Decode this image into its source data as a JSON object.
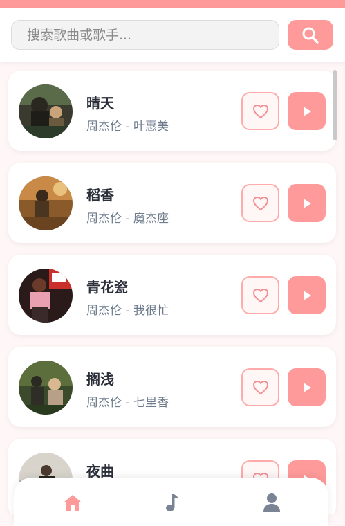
{
  "search": {
    "placeholder": "搜索歌曲或歌手..."
  },
  "songs": [
    {
      "title": "晴天",
      "artist": "周杰伦 - 叶惠美"
    },
    {
      "title": "稻香",
      "artist": "周杰伦 - 魔杰座"
    },
    {
      "title": "青花瓷",
      "artist": "周杰伦 - 我很忙"
    },
    {
      "title": "搁浅",
      "artist": "周杰伦 - 七里香"
    },
    {
      "title": "夜曲",
      "artist": ""
    }
  ],
  "nav": {
    "items": [
      {
        "icon": "home-icon",
        "active": true
      },
      {
        "icon": "music-note-icon",
        "active": false
      },
      {
        "icon": "user-icon",
        "active": false
      }
    ]
  },
  "colors": {
    "accent": "#ff9a9a",
    "like_border": "#ffabab",
    "title": "#2a2f3a",
    "subtitle": "#6d7b8c",
    "nav_inactive": "#7a8494",
    "background": "#fff7f7"
  }
}
